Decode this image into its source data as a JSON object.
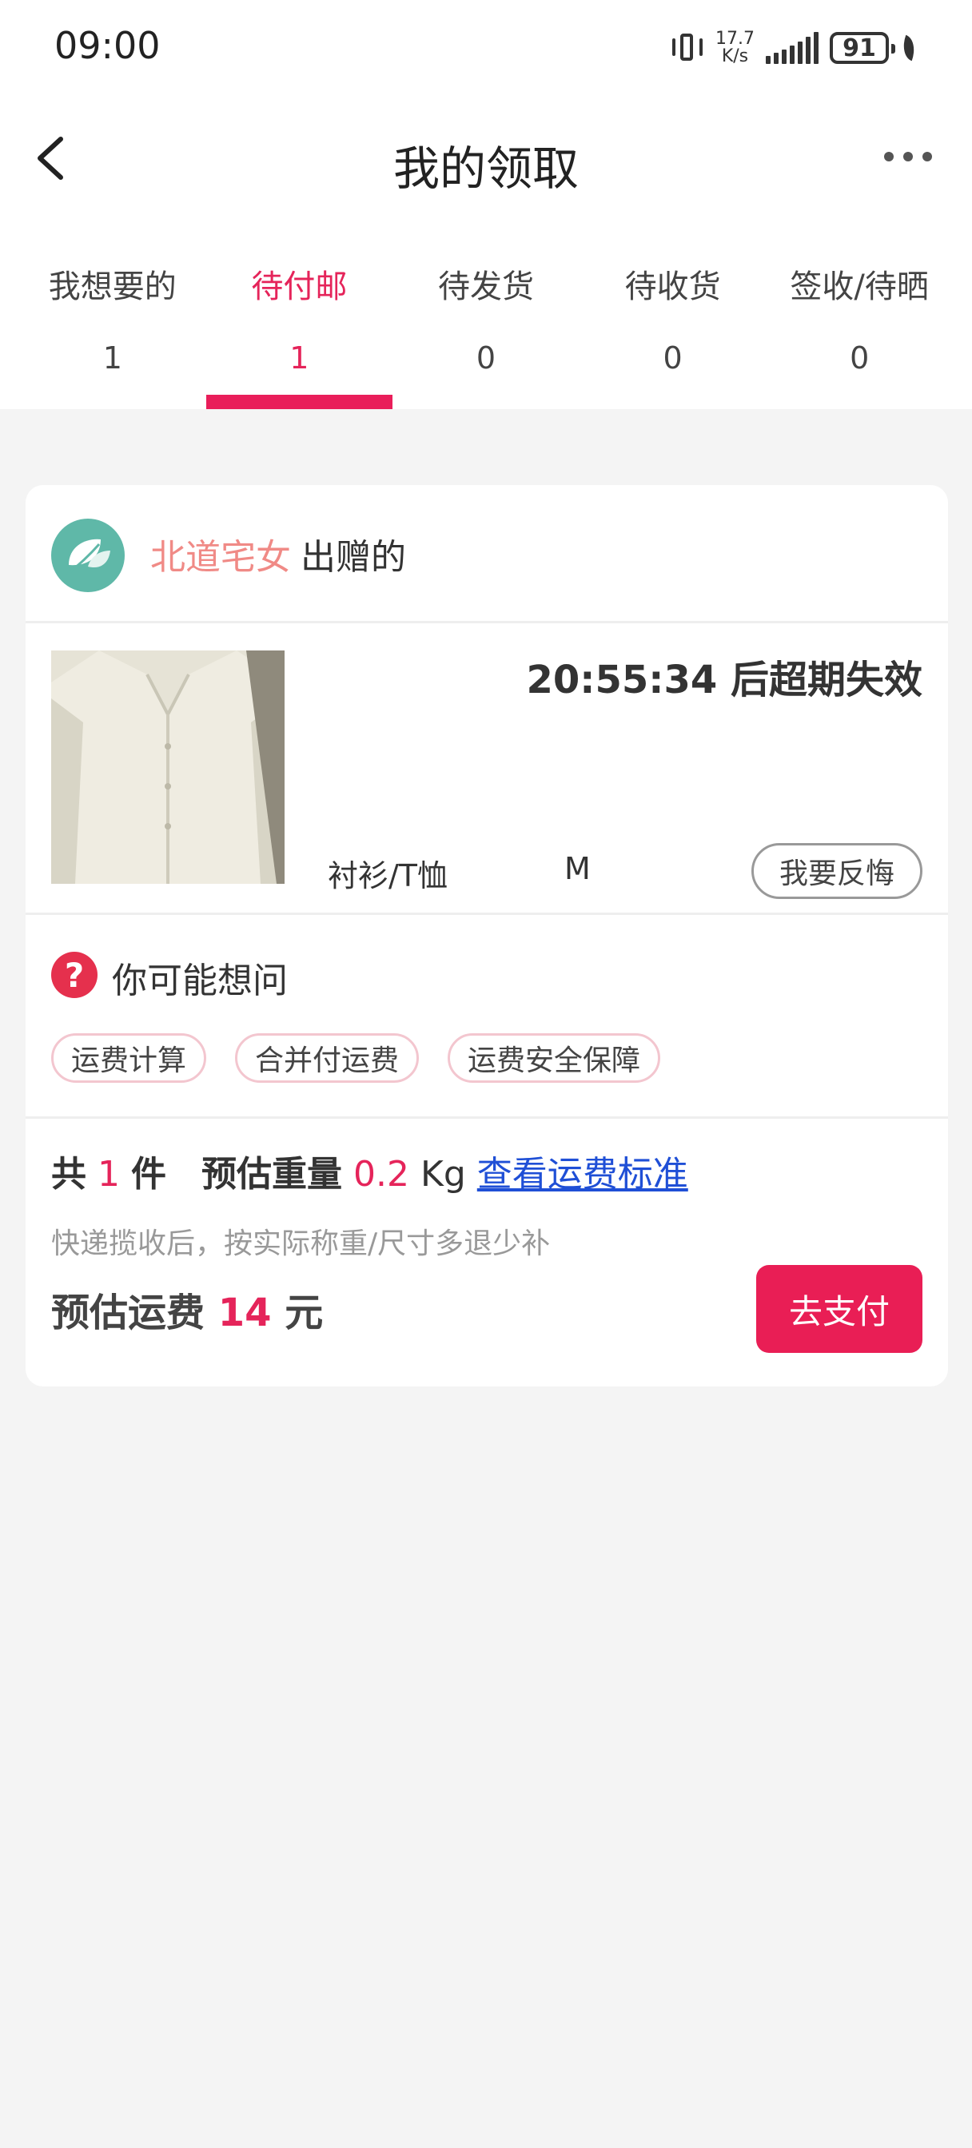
{
  "status_bar": {
    "time": "09:00",
    "net_speed_value": "17.7",
    "net_speed_unit": "K/s",
    "battery": "91"
  },
  "header": {
    "title": "我的领取",
    "back_icon": "chevron-left-icon",
    "more_icon": "more-dots-icon"
  },
  "tabs": [
    {
      "label": "我想要的",
      "count": "1"
    },
    {
      "label": "待付邮",
      "count": "1",
      "active": true
    },
    {
      "label": "待发货",
      "count": "0"
    },
    {
      "label": "待收货",
      "count": "0"
    },
    {
      "label": "签收/待晒",
      "count": "0"
    }
  ],
  "card": {
    "giver_name": "北道宅女",
    "giver_suffix": "出赠的",
    "countdown": "20:55:34 后超期失效",
    "item_category": "衬衫/T恤",
    "item_size": "M",
    "regret_button": "我要反悔",
    "faq_title": "你可能想问",
    "faq_chips": [
      "运费计算",
      "合并付运费",
      "运费安全保障"
    ],
    "summary": {
      "total_label": "共",
      "total_count": "1",
      "total_unit": "件",
      "weight_label": "预估重量",
      "weight_value": "0.2",
      "weight_unit": "Kg",
      "standard_link": "查看运费标准"
    },
    "note": "快递揽收后，按实际称重/尺寸多退少补",
    "fee_label": "预估运费",
    "fee_value": "14",
    "fee_unit": "元",
    "pay_button": "去支付"
  },
  "colors": {
    "accent": "#e91e5a",
    "giver_name": "#f08a86",
    "link": "#1f4fd6"
  }
}
